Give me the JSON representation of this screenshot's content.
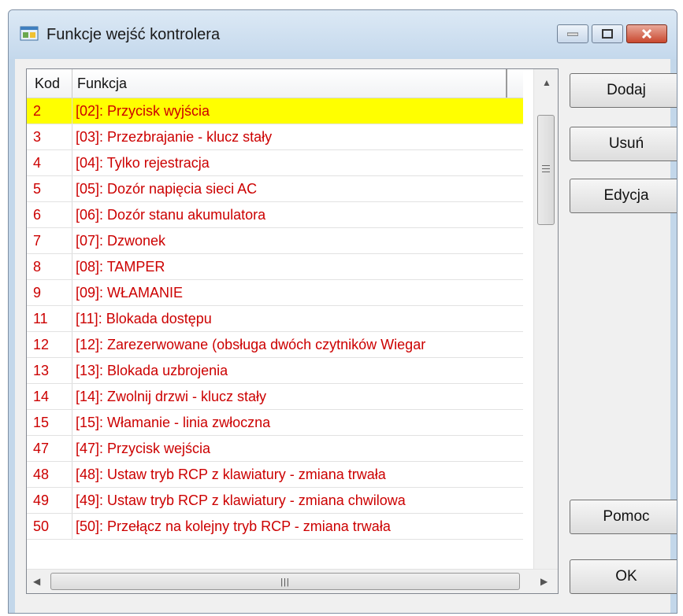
{
  "window": {
    "title": "Funkcje wejść kontrolera"
  },
  "grid": {
    "columns": [
      "Kod",
      "Funkcja"
    ],
    "rows": [
      {
        "kod": "2",
        "funkcja": "[02]: Przycisk wyjścia"
      },
      {
        "kod": "3",
        "funkcja": "[03]: Przezbrajanie - klucz stały"
      },
      {
        "kod": "4",
        "funkcja": "[04]: Tylko rejestracja"
      },
      {
        "kod": "5",
        "funkcja": "[05]: Dozór napięcia sieci AC"
      },
      {
        "kod": "6",
        "funkcja": "[06]: Dozór stanu akumulatora"
      },
      {
        "kod": "7",
        "funkcja": "[07]: Dzwonek"
      },
      {
        "kod": "8",
        "funkcja": "[08]: TAMPER"
      },
      {
        "kod": "9",
        "funkcja": "[09]: WŁAMANIE"
      },
      {
        "kod": "11",
        "funkcja": "[11]: Blokada dostępu"
      },
      {
        "kod": "12",
        "funkcja": "[12]: Zarezerwowane (obsługa dwóch czytników Wiegar"
      },
      {
        "kod": "13",
        "funkcja": "[13]: Blokada uzbrojenia"
      },
      {
        "kod": "14",
        "funkcja": "[14]: Zwolnij drzwi - klucz stały"
      },
      {
        "kod": "15",
        "funkcja": "[15]: Włamanie - linia zwłoczna"
      },
      {
        "kod": "47",
        "funkcja": "[47]: Przycisk wejścia"
      },
      {
        "kod": "48",
        "funkcja": "[48]: Ustaw tryb RCP z klawiatury - zmiana trwała"
      },
      {
        "kod": "49",
        "funkcja": "[49]: Ustaw tryb RCP z klawiatury - zmiana chwilowa"
      },
      {
        "kod": "50",
        "funkcja": "[50]: Przełącz na kolejny tryb RCP - zmiana trwała"
      }
    ],
    "selected_index": 0
  },
  "buttons": {
    "add": "Dodaj",
    "delete": "Usuń",
    "edit": "Edycja",
    "help": "Pomoc",
    "ok": "OK"
  },
  "colors": {
    "row_text": "#cc0000",
    "selected_row_bg": "#ffff00"
  },
  "icons": {
    "app": "app-window-icon",
    "minimize": "minimize-icon",
    "maximize": "maximize-icon",
    "close": "close-icon"
  }
}
